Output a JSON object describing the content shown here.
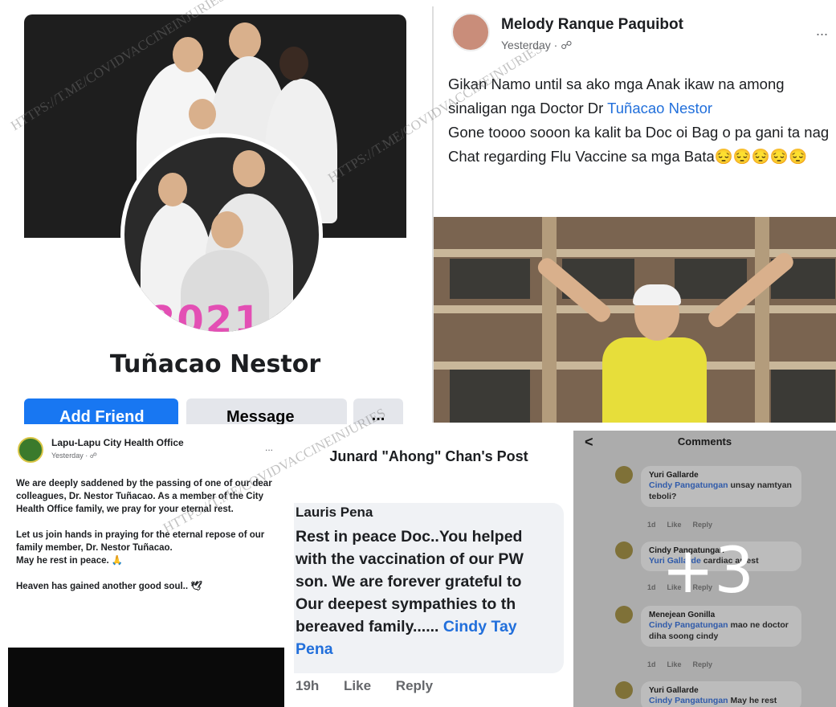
{
  "watermark": "HTTPS://T.ME/COVIDVACCINEINJURIES",
  "profile": {
    "name": "Tuñacao Nestor",
    "badge": "2021",
    "add_friend_label": "Add Friend",
    "message_label": "Message",
    "more_label": "...",
    "colors": {
      "primary": "#1877f2",
      "secondary": "#e4e6eb"
    }
  },
  "melody_post": {
    "author": "Melody Ranque Paquibot",
    "time": "Yesterday · ",
    "more": "...",
    "text_1": "Gikan Namo until sa ako mga Anak ikaw na among sinaligan nga Doctor Dr ",
    "text_link": "Tuñacao Nestor",
    "text_2": "Gone toooo sooon ka kalit ba Doc oi Bag o pa gani ta nag Chat regarding Flu Vaccine sa mga Bata",
    "emoji": "😔😔😔😔😔"
  },
  "health_office_post": {
    "author": "Lapu-Lapu City Health Office",
    "time": "Yesterday · ",
    "more": "...",
    "para_1": "We are deeply saddened by the passing of one of our dear colleagues, Dr. Nestor Tuñacao. As a member of the City Health Office family, we pray for your eternal rest.",
    "para_2": "Let us join hands in praying for the eternal repose of our family member, Dr. Nestor Tuñacao.",
    "para_3": "May he rest in peace. 🙏",
    "para_4": "Heaven has gained another good soul.. 🕊"
  },
  "junard_post": {
    "title": "Junard \"Ahong\" Chan's Post",
    "commenter": "Lauris Pena",
    "comment_lines": [
      "Rest in peace Doc..You helped",
      "with the vaccination of our PW",
      "son. We are forever grateful to",
      "Our deepest sympathies to th",
      "bereaved family...... "
    ],
    "comment_link_1": "Cindy Tay",
    "comment_link_2": "Pena",
    "time": "19h",
    "like_label": "Like",
    "reply_label": "Reply"
  },
  "comments_panel": {
    "back": "<",
    "title": "Comments",
    "more_count": "+3",
    "comments": [
      {
        "name": "Yuri Gallarde",
        "link": "Cindy Pangatungan",
        "text": " unsay namtyan teboli?",
        "time": "1d",
        "like": "Like",
        "reply": "Reply"
      },
      {
        "name": "Cindy Pangatungan",
        "link": "Yuri Gallarde",
        "text": " cardiac arrest",
        "time": "1d",
        "like": "Like",
        "reply": "Reply"
      },
      {
        "name": "Menejean Gonilla",
        "link": "Cindy Pangatungan",
        "text": " mao ne doctor diha soong cindy",
        "time": "1d",
        "like": "Like",
        "reply": "Reply"
      },
      {
        "name": "Yuri Gallarde",
        "link": "Cindy Pangatungan",
        "text": " May he rest",
        "time": "",
        "like": "",
        "reply": ""
      }
    ]
  }
}
